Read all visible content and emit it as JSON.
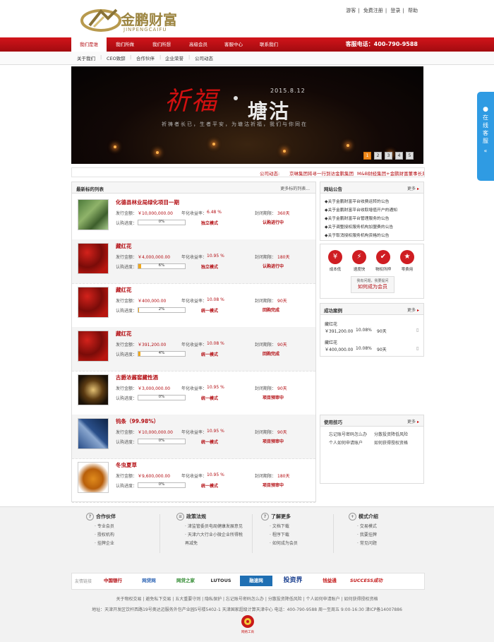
{
  "header": {
    "logo_cn": "金鹏财富",
    "logo_en": "JINPENGCAIFU",
    "top_links": [
      "游客",
      "免费注册",
      "登录",
      "帮助"
    ],
    "hotline": "客服电话：400-790-9588"
  },
  "nav": [
    "我们是谁",
    "我们所做",
    "我们所想",
    "高级会员",
    "客服中心",
    "联系我们"
  ],
  "subnav": [
    "关于我们",
    "CEO致辞",
    "合作伙伴",
    "企业荣誉",
    "公司动态"
  ],
  "banner": {
    "title_left": "祈福",
    "title_right": "塘沽",
    "date": "2015.8.12",
    "slogan": "祈祷者长已，生者平安，为塘沽祈福，我们与你同在",
    "pages": [
      "1",
      "2",
      "3",
      "4",
      "5"
    ],
    "active_page": "1"
  },
  "ticker": {
    "label": "公司动态:",
    "items": [
      "京琳集团将寻一行到访金鹏集团",
      "M&B财经集团+金鹏财富董事长周访"
    ]
  },
  "projects": {
    "title": "最新标的列表",
    "more": "更多标的列表...",
    "labels": {
      "amount": "发行金额：",
      "rate": "年化收益率：",
      "period": "封闭期限：",
      "progress": "认购进度："
    },
    "items": [
      {
        "name": "化德县林业局绿化项目一期",
        "amount": "￥10,000,000.00",
        "rate": "6.48 %",
        "period": "360天",
        "progress": "0%",
        "progress_value": 0,
        "mode": "独立模式",
        "status": "认购进行中",
        "thumb": "forest"
      },
      {
        "name": "藏红花",
        "amount": "￥4,000,000.00",
        "rate": "10.95 %",
        "period": "180天",
        "progress": "6%",
        "progress_value": 6,
        "mode": "独立模式",
        "status": "认购进行中",
        "thumb": "saffron"
      },
      {
        "name": "藏红花",
        "amount": "￥400,000.00",
        "rate": "10.08 %",
        "period": "90天",
        "progress": "2%",
        "progress_value": 2,
        "mode": "统一模式",
        "status": "回购完成",
        "thumb": "saffron"
      },
      {
        "name": "藏红花",
        "amount": "￥391,200.00",
        "rate": "10.08 %",
        "period": "90天",
        "progress": "4%",
        "progress_value": 4,
        "mode": "统一模式",
        "status": "回购完成",
        "thumb": "saffron"
      },
      {
        "name": "古爵浓酱窖藏性酒",
        "amount": "￥3,000,000.00",
        "rate": "10.95 %",
        "period": "90天",
        "progress": "0%",
        "progress_value": 0,
        "mode": "统一模式",
        "status": "项目预审中",
        "thumb": "wine"
      },
      {
        "name": "钨条（99.98%）",
        "amount": "￥10,000,000.00",
        "rate": "10.95 %",
        "period": "90天",
        "progress": "0%",
        "progress_value": 0,
        "mode": "统一模式",
        "status": "项目预审中",
        "thumb": "tungsten"
      },
      {
        "name": "冬虫夏草",
        "amount": "￥9,600,000.00",
        "rate": "10.95 %",
        "period": "180天",
        "progress": "0%",
        "progress_value": 0,
        "mode": "统一模式",
        "status": "项目预审中",
        "thumb": "cordyceps"
      }
    ]
  },
  "notice": {
    "title": "网站公告",
    "more": "更多",
    "items": [
      "◆关于金鹏财富平台收费运转的公告",
      "◆关于金鹏财富平台收取增值开户的通知",
      "◆关于金鹏财富平台管理服务的公告",
      "◆关于调整授权服务机构加盟费的公告",
      "◆关于取消授权服务机构资格的公告"
    ]
  },
  "features": {
    "items": [
      "成本低",
      "速度快",
      "物权所押",
      "零费用"
    ],
    "join_hint": "我有问题，我要提问",
    "join_label": "如何成为会员"
  },
  "cases": {
    "title": "成功案例",
    "more": "更多",
    "items": [
      {
        "name": "藏红花",
        "amount": "￥391,200.00",
        "rate": "10.08%",
        "period": "90天"
      },
      {
        "name": "藏红花",
        "amount": "￥400,000.00",
        "rate": "10.08%",
        "period": "90天"
      }
    ]
  },
  "tips": {
    "title": "使用技巧",
    "more": "更多",
    "items": [
      "忘记账号密码怎么办",
      "分散投资降低风险",
      "个人如何申请账户",
      "如何获得授权资格"
    ]
  },
  "kefu": "在线客服",
  "footer": {
    "columns": [
      {
        "title": "合作伙伴",
        "items": [
          "专业会员",
          "授权机构",
          "挂牌企业"
        ]
      },
      {
        "title": "政策法规",
        "items": [
          "津监管委员电局健康发展意见",
          "天津六大行业小微企业所得税",
          "再减免"
        ]
      },
      {
        "title": "了解更多",
        "items": [
          "文档下载",
          "程序下载",
          "如何成为会员"
        ]
      },
      {
        "title": "模式介绍",
        "items": [
          "交易模式",
          "我要挂牌",
          "常见问题"
        ]
      }
    ],
    "partners_label": "友情链接",
    "partners": [
      "中国银行",
      "网贷网",
      "网贷之家",
      "LUTOUS",
      "融速网",
      "投资界",
      "钱益通",
      "SUCCESS成功"
    ],
    "links": [
      "关于物权交易",
      "避免私下交易",
      "五大重要守则",
      "隐私保护",
      "忘记账号密码怎么办",
      "分散投资降低风险",
      "个人如何申请账户",
      "如何获得授权资格"
    ],
    "address": "地址：天津开发区饮杆西路19号奥达迈服务外包产业园5号楼5402-1  天津国家超级计算天津中心 电话：400-790-9588  周一至周五 9:00-16:30  津ICP备14007886",
    "badge_label": "网络工商"
  }
}
